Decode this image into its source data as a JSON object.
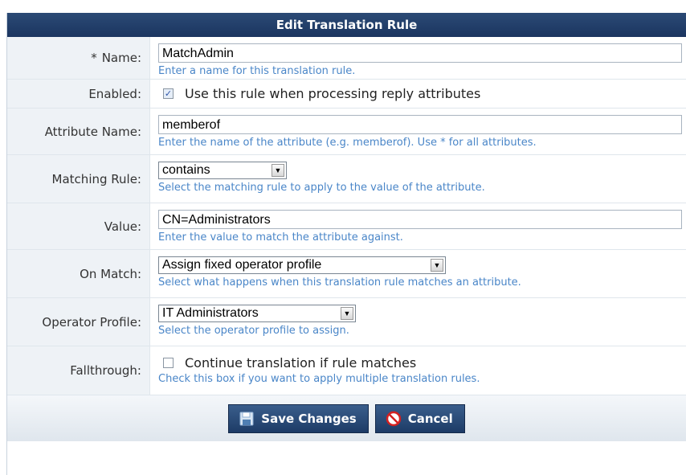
{
  "header": {
    "title": "Edit Translation Rule"
  },
  "form": {
    "name": {
      "required_mark": "*",
      "label": "Name:",
      "value": "MatchAdmin",
      "hint": "Enter a name for this translation rule."
    },
    "enabled": {
      "label": "Enabled:",
      "checked": true,
      "text": "Use this rule when processing reply attributes"
    },
    "attribute_name": {
      "label": "Attribute Name:",
      "value": "memberof",
      "hint": "Enter the name of the attribute (e.g. memberof). Use * for all attributes."
    },
    "matching_rule": {
      "label": "Matching Rule:",
      "selected": "contains",
      "hint": "Select the matching rule to apply to the value of the attribute."
    },
    "value": {
      "label": "Value:",
      "value": "CN=Administrators",
      "hint": "Enter the value to match the attribute against."
    },
    "on_match": {
      "label": "On Match:",
      "selected": "Assign fixed operator profile",
      "hint": "Select what happens when this translation rule matches an attribute."
    },
    "operator_profile": {
      "label": "Operator Profile:",
      "selected": "IT Administrators",
      "hint": "Select the operator profile to assign."
    },
    "fallthrough": {
      "label": "Fallthrough:",
      "checked": false,
      "text": "Continue translation if rule matches",
      "hint": "Check this box if you want to apply multiple translation rules."
    }
  },
  "footer": {
    "save_label": "Save Changes",
    "cancel_label": "Cancel",
    "save_icon": "floppy-disk-icon",
    "cancel_icon": "no-entry-icon"
  },
  "colors": {
    "header_bg": "#1f3b66",
    "hint_text": "#4a86c8",
    "label_bg": "#eef2f6"
  }
}
